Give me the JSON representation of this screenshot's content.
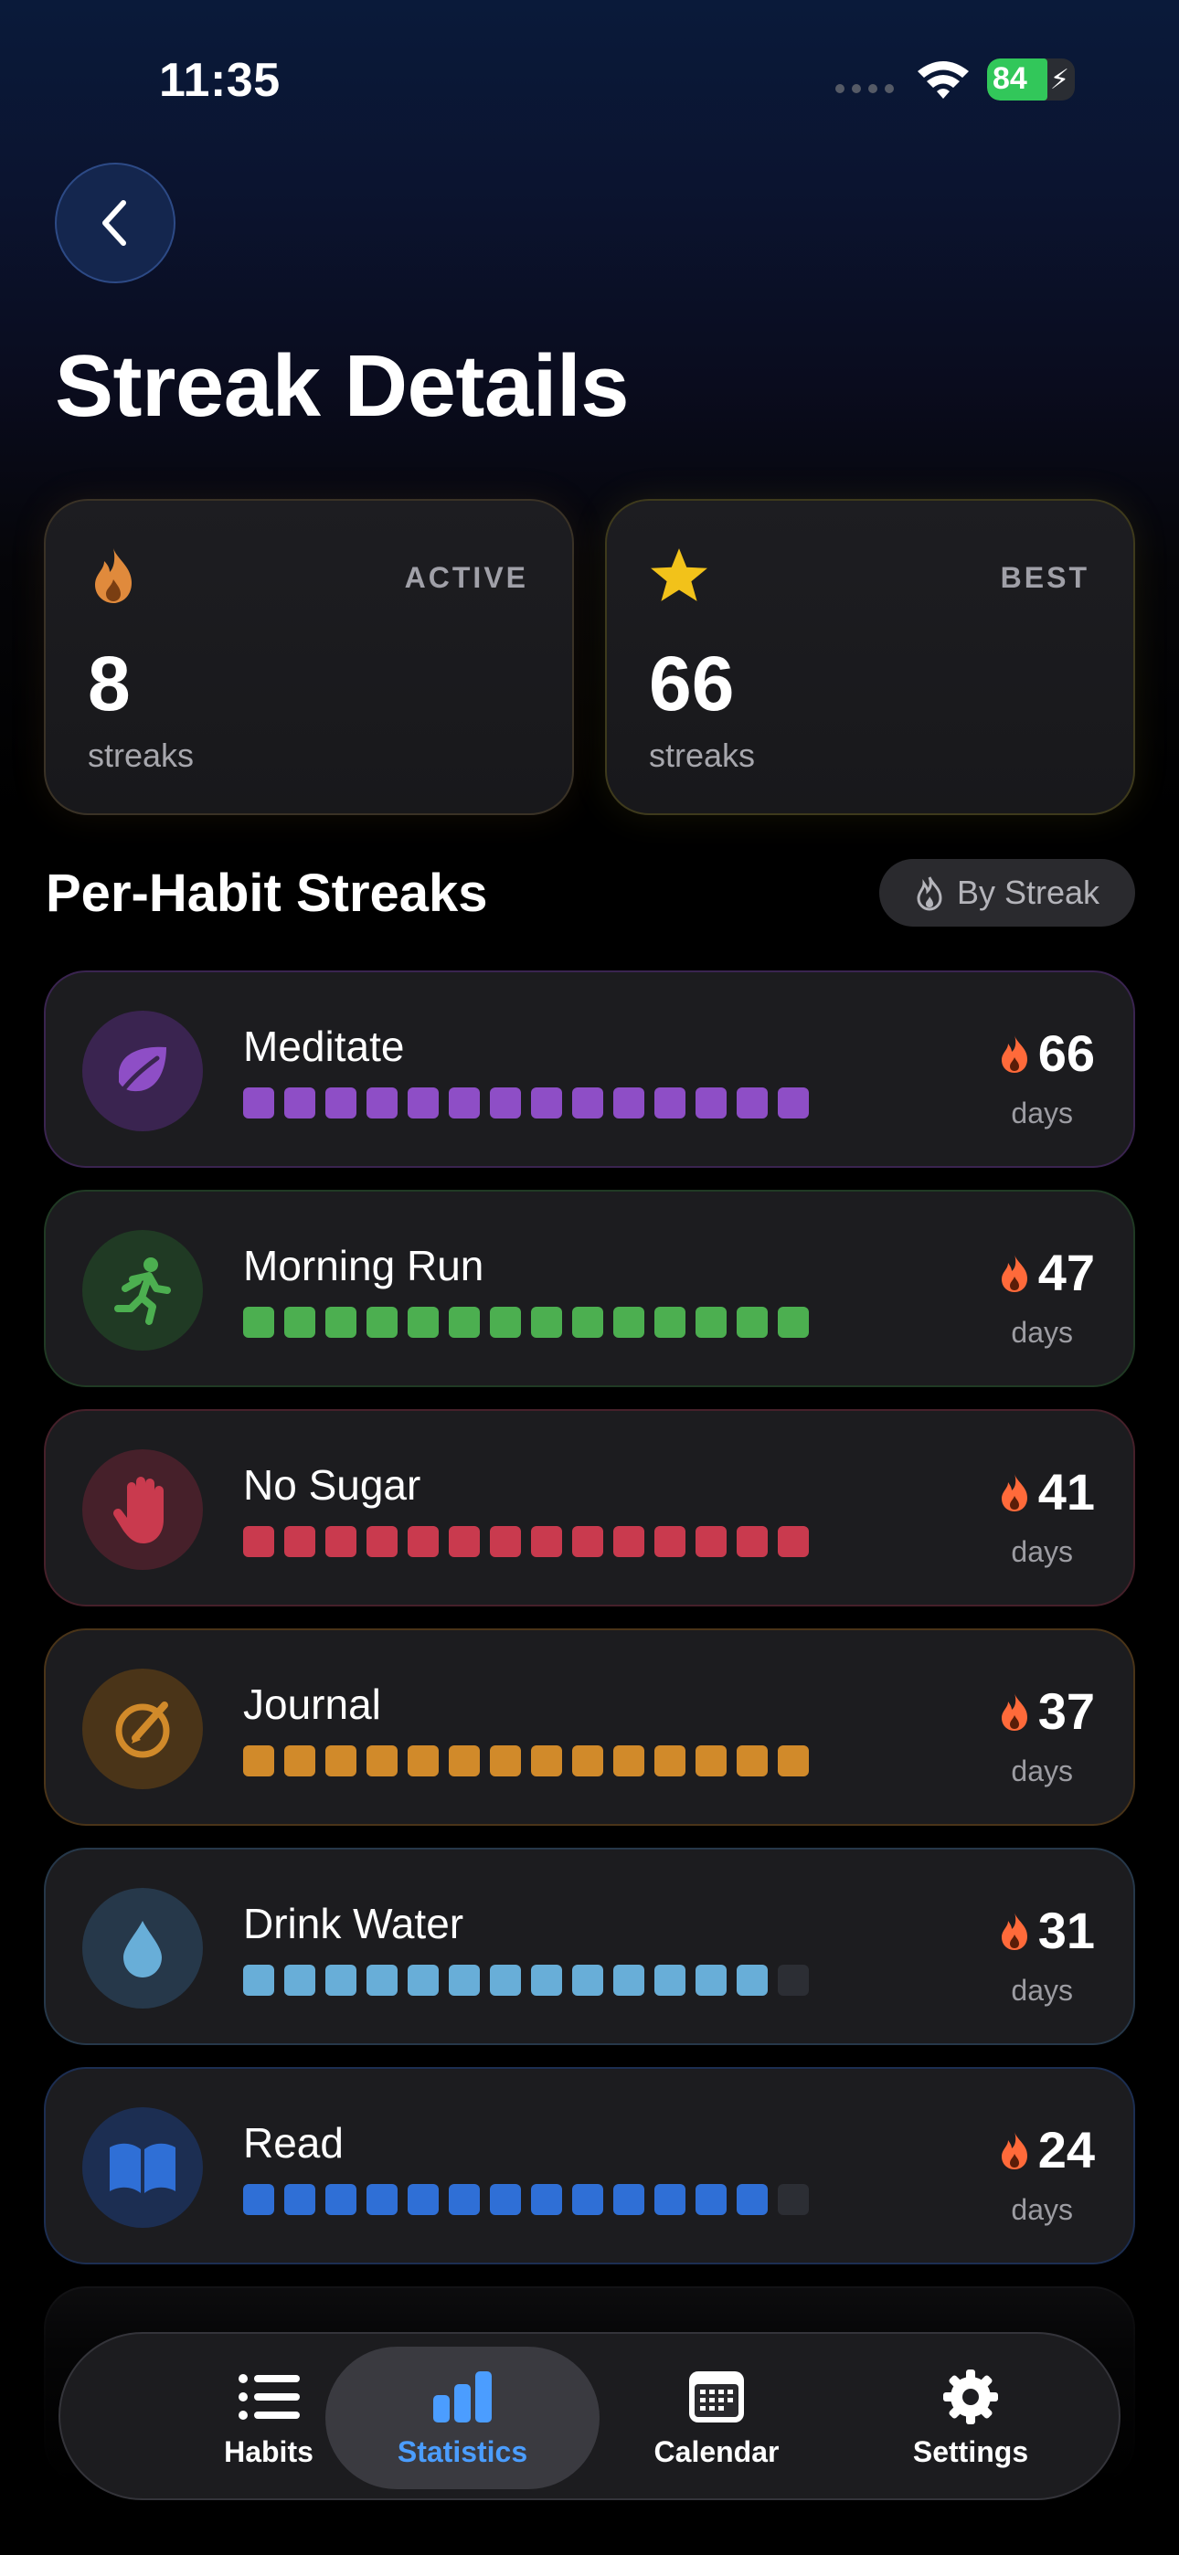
{
  "status_bar": {
    "time": "11:35",
    "battery_percent": 84,
    "battery_label": "84",
    "charging": true,
    "icons": [
      "signal-dots-icon",
      "wifi-icon",
      "battery-icon"
    ]
  },
  "header": {
    "back_icon": "chevron-left-icon",
    "title": "Streak Details"
  },
  "summary": {
    "active": {
      "label": "ACTIVE",
      "value": "8",
      "unit": "streaks",
      "icon": "flame-icon"
    },
    "best": {
      "label": "BEST",
      "value": "66",
      "unit": "streaks",
      "icon": "star-icon"
    }
  },
  "section": {
    "title": "Per-Habit Streaks",
    "sort_label": "By Streak",
    "sort_icon": "flame-outline-icon"
  },
  "habits": [
    {
      "name": "Meditate",
      "streak": "66",
      "unit": "days",
      "icon": "leaf-icon",
      "color": "#8e4ec6",
      "bg": "#3a2450",
      "filled": 14,
      "total": 14
    },
    {
      "name": "Morning Run",
      "streak": "47",
      "unit": "days",
      "icon": "runner-icon",
      "color": "#4caf50",
      "bg": "#203a24",
      "filled": 14,
      "total": 14
    },
    {
      "name": "No Sugar",
      "streak": "41",
      "unit": "days",
      "icon": "hand-stop-icon",
      "color": "#c93a4e",
      "bg": "#46202a",
      "filled": 14,
      "total": 14
    },
    {
      "name": "Journal",
      "streak": "37",
      "unit": "days",
      "icon": "pencil-circle-icon",
      "color": "#d18a2a",
      "bg": "#4a3418",
      "filled": 14,
      "total": 14
    },
    {
      "name": "Drink Water",
      "streak": "31",
      "unit": "days",
      "icon": "water-drop-icon",
      "color": "#68aed8",
      "bg": "#26384a",
      "filled": 13,
      "total": 14
    },
    {
      "name": "Read",
      "streak": "24",
      "unit": "days",
      "icon": "book-icon",
      "color": "#2f6fd6",
      "bg": "#1c2e52",
      "filled": 13,
      "total": 14
    }
  ],
  "tabs": [
    {
      "label": "Habits",
      "icon": "list-icon",
      "active": false
    },
    {
      "label": "Statistics",
      "icon": "bar-chart-icon",
      "active": true
    },
    {
      "label": "Calendar",
      "icon": "calendar-icon",
      "active": false
    },
    {
      "label": "Settings",
      "icon": "gear-icon",
      "active": false
    }
  ],
  "colors": {
    "accent_blue": "#4b9dff",
    "flame": "#ff7a3d",
    "star": "#f5c518"
  }
}
